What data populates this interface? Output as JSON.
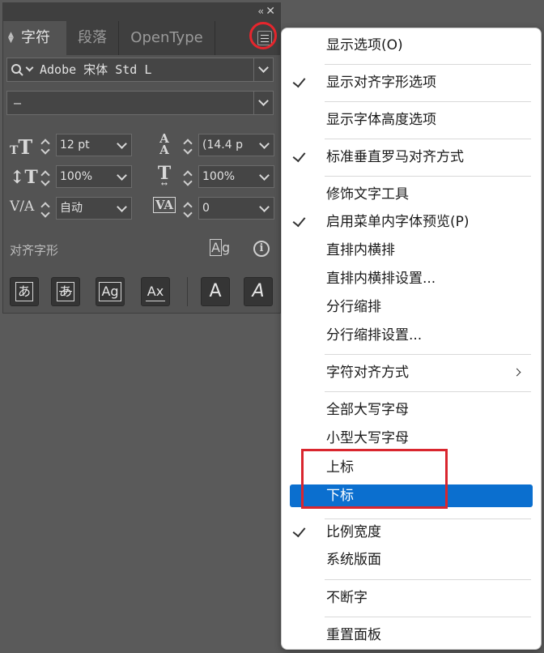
{
  "panel": {
    "tabs": [
      {
        "label": "字符",
        "active": true
      },
      {
        "label": "段落",
        "active": false
      },
      {
        "label": "OpenType",
        "active": false
      }
    ],
    "font_family": "Adobe 宋体 Std L",
    "font_style": "–",
    "font_size": "12 pt",
    "leading": "(14.4 p",
    "vertical_scale": "100%",
    "horizontal_scale": "100%",
    "kerning": "自动",
    "tracking": "0",
    "glyph_section_label": "对齐字形",
    "glyph_buttons": [
      "あ",
      "あ",
      "Ag",
      "Ax",
      "A",
      "A"
    ]
  },
  "menu": {
    "items": [
      {
        "label": "显示选项(O)",
        "checked": false
      },
      {
        "label": "显示对齐字形选项",
        "checked": true
      },
      {
        "label": "显示字体高度选项",
        "checked": false
      },
      {
        "label": "标准垂直罗马对齐方式",
        "checked": true
      },
      {
        "label": "修饰文字工具",
        "checked": false
      },
      {
        "label": "启用菜单内字体预览(P)",
        "checked": true
      },
      {
        "label": "直排内横排",
        "checked": false
      },
      {
        "label": "直排内横排设置...",
        "checked": false
      },
      {
        "label": "分行缩排",
        "checked": false
      },
      {
        "label": "分行缩排设置...",
        "checked": false
      },
      {
        "label": "字符对齐方式",
        "checked": false,
        "submenu": true
      },
      {
        "label": "全部大写字母",
        "checked": false
      },
      {
        "label": "小型大写字母",
        "checked": false
      },
      {
        "label": "上标",
        "checked": false
      },
      {
        "label": "下标",
        "checked": false,
        "highlighted": true
      },
      {
        "label": "比例宽度",
        "checked": true
      },
      {
        "label": "系统版面",
        "checked": false
      },
      {
        "label": "不断字",
        "checked": false
      },
      {
        "label": "重置面板",
        "checked": false
      }
    ]
  },
  "colors": {
    "highlight": "#0b6fcf",
    "annotation_red": "#e5262d"
  }
}
